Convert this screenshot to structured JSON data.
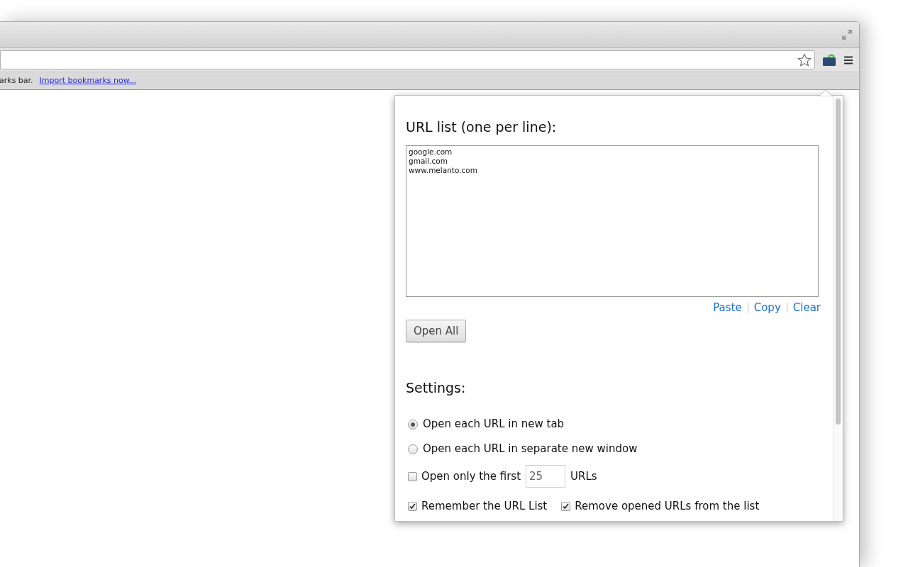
{
  "bookmarks_bar": {
    "text": "arks bar.",
    "link": "Import bookmarks now..."
  },
  "popup": {
    "url_list_title": "URL list (one per line):",
    "urls": [
      "google.com",
      "gmail.com",
      "www.melanto.com"
    ],
    "links": [
      "Paste",
      "Copy",
      "Clear"
    ],
    "open_all_button": "Open All",
    "settings_title": "Settings:",
    "rows": [
      {
        "kind": "radio",
        "label": "Open each URL in new tab",
        "selected": true
      },
      {
        "kind": "radio",
        "label": "Open each URL in separate new window",
        "selected": false
      },
      {
        "kind": "limit",
        "label": "Open only the first",
        "checked": false,
        "value": "25",
        "suffix": "URLs"
      },
      {
        "kind": "pair",
        "items": [
          {
            "label": "Remember the URL List",
            "checked": true
          },
          {
            "label": "Remove opened URLs from the list",
            "checked": true
          }
        ]
      }
    ]
  }
}
